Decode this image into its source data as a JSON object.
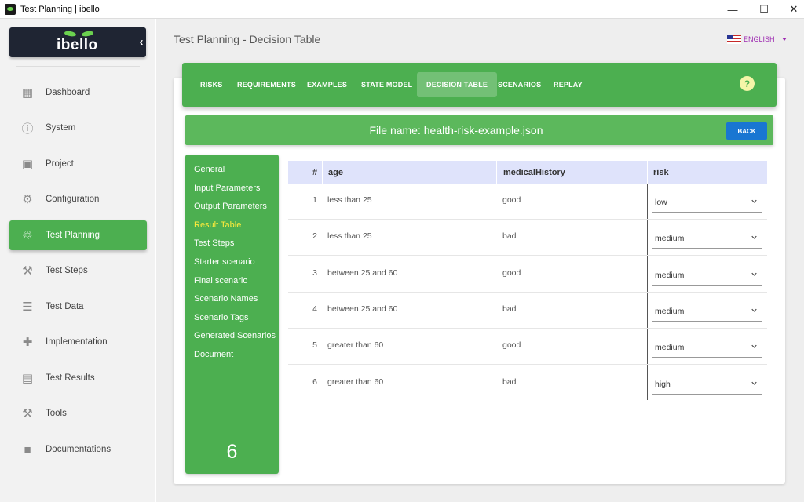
{
  "window": {
    "title": "Test Planning | ibello",
    "minimize": "—",
    "maximize": "☐",
    "close": "✕"
  },
  "logo": {
    "text": "ibello",
    "collapse": "‹"
  },
  "sidebar": {
    "items": [
      {
        "label": "Dashboard",
        "icon": "dashboard-icon",
        "glyph": "▦"
      },
      {
        "label": "System",
        "icon": "info-icon",
        "glyph": "ⓘ"
      },
      {
        "label": "Project",
        "icon": "briefcase-icon",
        "glyph": "▣"
      },
      {
        "label": "Configuration",
        "icon": "gear-icon",
        "glyph": "⚙"
      },
      {
        "label": "Test Planning",
        "icon": "route-icon",
        "glyph": "♲",
        "active": true
      },
      {
        "label": "Test Steps",
        "icon": "walking-icon",
        "glyph": "⚒"
      },
      {
        "label": "Test Data",
        "icon": "list-icon",
        "glyph": "☰"
      },
      {
        "label": "Implementation",
        "icon": "implementation-icon",
        "glyph": "✚"
      },
      {
        "label": "Test Results",
        "icon": "library-icon",
        "glyph": "▤"
      },
      {
        "label": "Tools",
        "icon": "tools-icon",
        "glyph": "⚒"
      },
      {
        "label": "Documentations",
        "icon": "document-icon",
        "glyph": "■"
      }
    ]
  },
  "header": {
    "title": "Test Planning - Decision Table",
    "language": "ENGLISH"
  },
  "tabs": [
    {
      "label": "RISKS"
    },
    {
      "label": "REQUIREMENTS"
    },
    {
      "label": "EXAMPLES"
    },
    {
      "label": "STATE MODEL"
    },
    {
      "label": "DECISION TABLE",
      "active": true
    },
    {
      "label": "SCENARIOS"
    },
    {
      "label": "REPLAY"
    }
  ],
  "help": "?",
  "file": {
    "name": "File name: health-risk-example.json",
    "back": "BACK"
  },
  "subnav": {
    "items": [
      {
        "label": "General"
      },
      {
        "label": "Input Parameters"
      },
      {
        "label": "Output Parameters"
      },
      {
        "label": "Result Table",
        "active": true
      },
      {
        "label": "Test Steps"
      },
      {
        "label": "Starter scenario"
      },
      {
        "label": "Final scenario"
      },
      {
        "label": "Scenario Names"
      },
      {
        "label": "Scenario Tags"
      },
      {
        "label": "Generated Scenarios"
      },
      {
        "label": "Document"
      }
    ],
    "count": "6"
  },
  "table": {
    "headers": {
      "num": "#",
      "age": "age",
      "medicalHistory": "medicalHistory",
      "risk": "risk"
    },
    "rows": [
      {
        "num": "1",
        "age": "less than 25",
        "medicalHistory": "good",
        "risk": "low"
      },
      {
        "num": "2",
        "age": "less than 25",
        "medicalHistory": "bad",
        "risk": "medium"
      },
      {
        "num": "3",
        "age": "between 25 and 60",
        "medicalHistory": "good",
        "risk": "medium"
      },
      {
        "num": "4",
        "age": "between 25 and 60",
        "medicalHistory": "bad",
        "risk": "medium"
      },
      {
        "num": "5",
        "age": "greater than 60",
        "medicalHistory": "good",
        "risk": "medium"
      },
      {
        "num": "6",
        "age": "greater than 60",
        "medicalHistory": "bad",
        "risk": "high"
      }
    ]
  },
  "colors": {
    "accent": "#4caf50",
    "back_button": "#1976d2",
    "active_subnav": "#ffeb3b",
    "table_header": "#dfe3fb"
  }
}
